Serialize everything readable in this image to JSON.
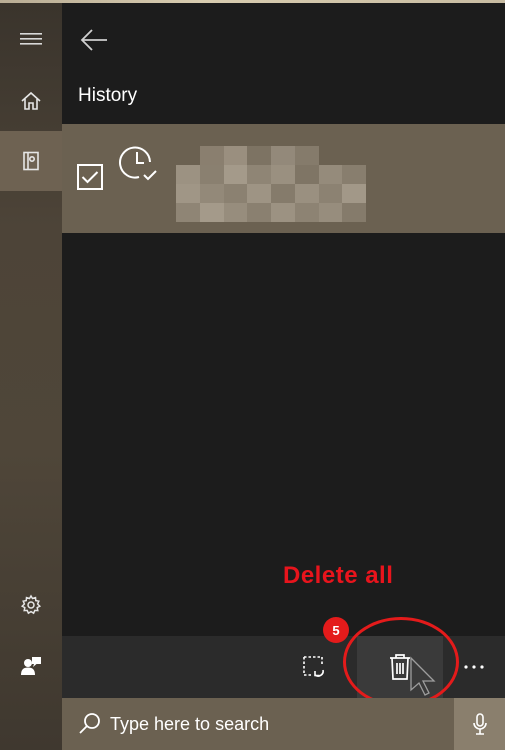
{
  "header": {
    "title": "History"
  },
  "sidebar": {
    "items": [
      {
        "name": "menu",
        "icon": "hamburger-icon"
      },
      {
        "name": "home",
        "icon": "home-icon"
      },
      {
        "name": "notebook",
        "icon": "notebook-icon",
        "active": true
      },
      {
        "name": "settings",
        "icon": "gear-icon"
      },
      {
        "name": "feedback",
        "icon": "feedback-icon"
      }
    ]
  },
  "history": {
    "items": [
      {
        "checked": true,
        "icon": "clock-check-icon"
      }
    ]
  },
  "annotation": {
    "label": "Delete all",
    "step": "5",
    "color": "#e41b1b"
  },
  "toolbar": {
    "buttons": [
      {
        "name": "undo-selection",
        "icon": "select-undo-icon"
      },
      {
        "name": "delete-all",
        "icon": "trash-icon"
      },
      {
        "name": "more",
        "icon": "more-icon"
      }
    ]
  },
  "search": {
    "placeholder": "Type here to search"
  },
  "colors": {
    "accent": "#6b6151",
    "panel": "#1c1c1c",
    "rail": "#4d4438",
    "toolbar": "#2b2b2b"
  }
}
